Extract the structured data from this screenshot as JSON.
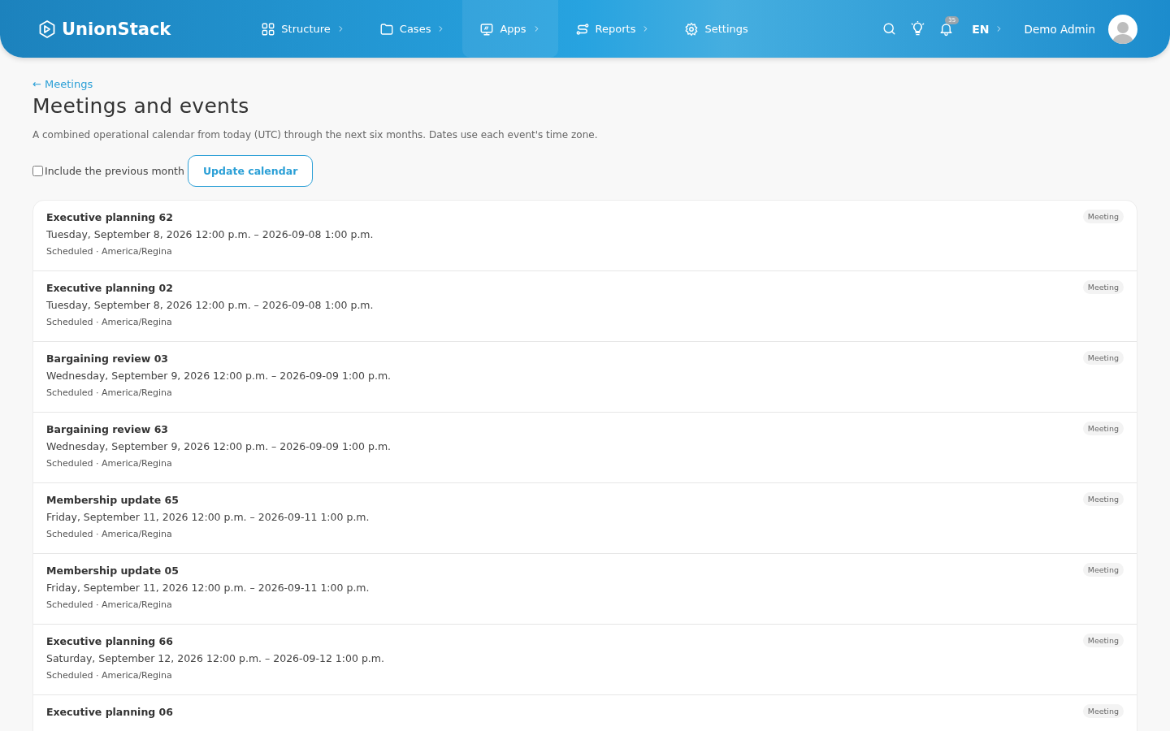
{
  "header": {
    "brand": "UnionStack",
    "nav": [
      {
        "label": "Structure",
        "dropdown": true,
        "selected": false
      },
      {
        "label": "Cases",
        "dropdown": true,
        "selected": false
      },
      {
        "label": "Apps",
        "dropdown": true,
        "selected": true
      },
      {
        "label": "Reports",
        "dropdown": true,
        "selected": false
      },
      {
        "label": "Settings",
        "dropdown": false,
        "selected": false
      }
    ],
    "notification_count": "35",
    "language": "EN",
    "user": "Demo Admin"
  },
  "back_link": "← Meetings",
  "title": "Meetings and events",
  "description": "A combined operational calendar from today (UTC) through the next six months. Dates use each event's time zone.",
  "include_previous": {
    "label": "Include the previous month",
    "checked": false
  },
  "update_button": "Update calendar",
  "events": [
    {
      "title": "Executive planning 62",
      "when": "Tuesday, September 8, 2026 12:00 p.m. – 2026-09-08 1:00 p.m.",
      "status": "Scheduled · America/Regina",
      "type": "Meeting"
    },
    {
      "title": "Executive planning 02",
      "when": "Tuesday, September 8, 2026 12:00 p.m. – 2026-09-08 1:00 p.m.",
      "status": "Scheduled · America/Regina",
      "type": "Meeting"
    },
    {
      "title": "Bargaining review 03",
      "when": "Wednesday, September 9, 2026 12:00 p.m. – 2026-09-09 1:00 p.m.",
      "status": "Scheduled · America/Regina",
      "type": "Meeting"
    },
    {
      "title": "Bargaining review 63",
      "when": "Wednesday, September 9, 2026 12:00 p.m. – 2026-09-09 1:00 p.m.",
      "status": "Scheduled · America/Regina",
      "type": "Meeting"
    },
    {
      "title": "Membership update 65",
      "when": "Friday, September 11, 2026 12:00 p.m. – 2026-09-11 1:00 p.m.",
      "status": "Scheduled · America/Regina",
      "type": "Meeting"
    },
    {
      "title": "Membership update 05",
      "when": "Friday, September 11, 2026 12:00 p.m. – 2026-09-11 1:00 p.m.",
      "status": "Scheduled · America/Regina",
      "type": "Meeting"
    },
    {
      "title": "Executive planning 66",
      "when": "Saturday, September 12, 2026 12:00 p.m. – 2026-09-12 1:00 p.m.",
      "status": "Scheduled · America/Regina",
      "type": "Meeting"
    },
    {
      "title": "Executive planning 06",
      "type": "Meeting"
    }
  ]
}
